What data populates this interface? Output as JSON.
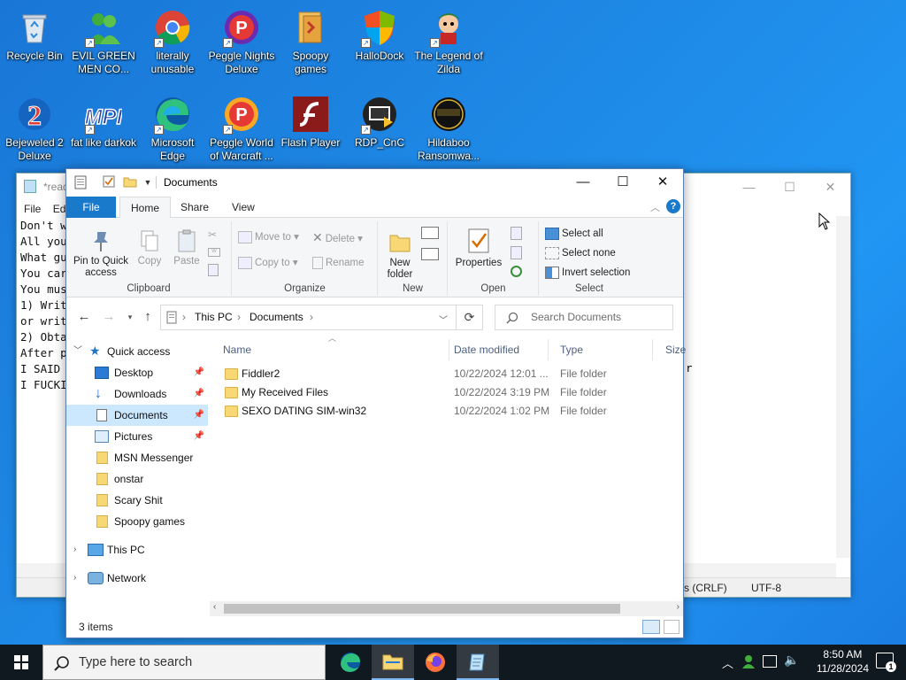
{
  "desktop": {
    "icons": [
      {
        "label": "Recycle Bin"
      },
      {
        "label": "EVIL GREEN MEN CO..."
      },
      {
        "label": "literally unusable"
      },
      {
        "label": "Peggle Nights Deluxe"
      },
      {
        "label": "Spoopy games"
      },
      {
        "label": "HalloDock"
      },
      {
        "label": "The Legend of Zilda"
      },
      {
        "label": "Bejeweled 2 Deluxe"
      },
      {
        "label": "fat like darkok"
      },
      {
        "label": "Microsoft Edge"
      },
      {
        "label": "Peggle World of Warcraft ..."
      },
      {
        "label": "Flash Player"
      },
      {
        "label": "RDP_CnC"
      },
      {
        "label": "Hildaboo Ransomwa..."
      }
    ]
  },
  "notepad": {
    "title": "*read",
    "menu": {
      "file": "File",
      "edit": "Edi"
    },
    "lines": [
      "Don't w",
      "",
      "All you",
      "",
      "What gu",
      "",
      "You car",
      "",
      "You mus",
      "1) Writ",
      "or writ",
      "",
      "2) Obta",
      "After p",
      "I SAID",
      "I FUCKI"
    ],
    "right_fragment": "r",
    "status": {
      "encoding_eol": "s (CRLF)",
      "charset": "UTF-8"
    }
  },
  "explorer": {
    "title": "Documents",
    "window_controls": {
      "minimize": "—",
      "maximize": "☐",
      "close": "✕"
    },
    "tabs": {
      "file": "File",
      "home": "Home",
      "share": "Share",
      "view": "View"
    },
    "ribbon": {
      "clipboard": {
        "label": "Clipboard",
        "pin": "Pin to Quick access",
        "copy": "Copy",
        "paste": "Paste"
      },
      "organize": {
        "label": "Organize",
        "move_to": "Move to",
        "copy_to": "Copy to",
        "delete": "Delete",
        "rename": "Rename"
      },
      "new": {
        "label": "New",
        "new_folder": "New folder"
      },
      "open": {
        "label": "Open",
        "properties": "Properties"
      },
      "select": {
        "label": "Select",
        "select_all": "Select all",
        "select_none": "Select none",
        "invert": "Invert selection"
      }
    },
    "address": {
      "crumbs": [
        "This PC",
        "Documents"
      ]
    },
    "search": {
      "placeholder": "Search Documents"
    },
    "nav": {
      "quick_access": "Quick access",
      "items": [
        "Desktop",
        "Downloads",
        "Documents",
        "Pictures",
        "MSN Messenger",
        "onstar",
        "Scary Shit",
        "Spoopy games"
      ],
      "this_pc": "This PC",
      "network": "Network"
    },
    "columns": {
      "name": "Name",
      "date": "Date modified",
      "type": "Type",
      "size": "Size"
    },
    "files": [
      {
        "name": "Fiddler2",
        "date": "10/22/2024 12:01 ...",
        "type": "File folder"
      },
      {
        "name": "My Received Files",
        "date": "10/22/2024 3:19 PM",
        "type": "File folder"
      },
      {
        "name": "SEXO DATING SIM-win32",
        "date": "10/22/2024 1:02 PM",
        "type": "File folder"
      }
    ],
    "status": "3 items"
  },
  "taskbar": {
    "search_placeholder": "Type here to search",
    "time": "8:50 AM",
    "date": "11/28/2024",
    "notification_count": "1"
  },
  "colors": {
    "accent": "#1979ca",
    "selection": "#cce8ff",
    "folder": "#f8d775",
    "desktop": "#1e88e5"
  }
}
